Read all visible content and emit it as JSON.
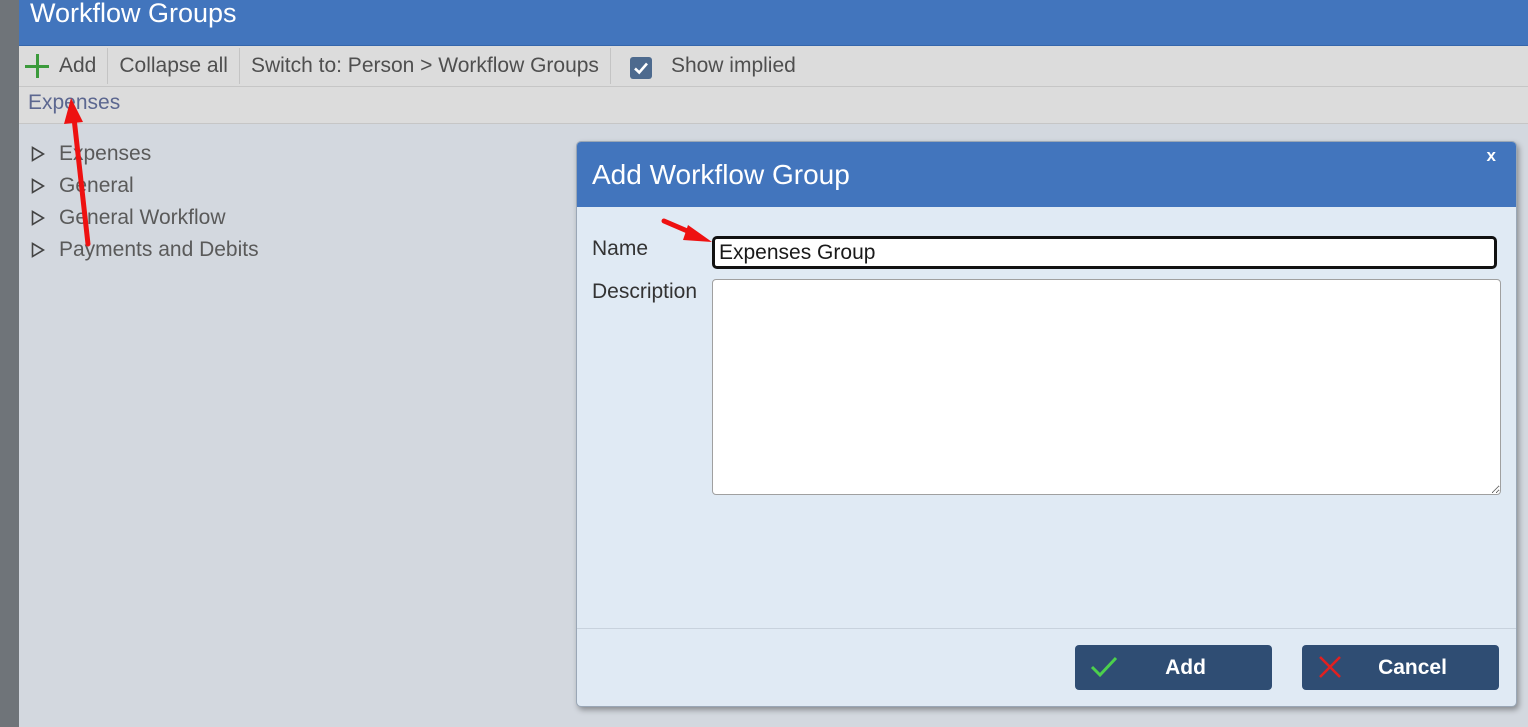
{
  "app": {
    "title": "Workflow Groups"
  },
  "toolbar": {
    "add_label": "Add",
    "collapse_label": "Collapse all",
    "switch_label": "Switch to: Person > Workflow Groups",
    "show_implied_label": "Show implied",
    "show_implied_checked": true
  },
  "breadcrumb": {
    "label": "Expenses"
  },
  "tree": {
    "items": [
      {
        "label": "Expenses"
      },
      {
        "label": "General"
      },
      {
        "label": "General Workflow"
      },
      {
        "label": "Payments and Debits"
      }
    ]
  },
  "dialog": {
    "title": "Add Workflow Group",
    "close_label": "x",
    "name_label": "Name",
    "name_value": "Expenses Group",
    "description_label": "Description",
    "description_value": "",
    "add_button_label": "Add",
    "cancel_button_label": "Cancel"
  },
  "colors": {
    "header_blue": "#4275bd",
    "button_navy": "#2f4d73",
    "add_green": "#3b9a3b",
    "ok_green": "#4cd04c",
    "cancel_red": "#e02020",
    "annotation_red": "#ee1111"
  },
  "icons": [
    "plus-icon",
    "checkbox-check-icon",
    "triangle-right-icon",
    "check-icon",
    "x-icon",
    "annotation-arrow"
  ]
}
